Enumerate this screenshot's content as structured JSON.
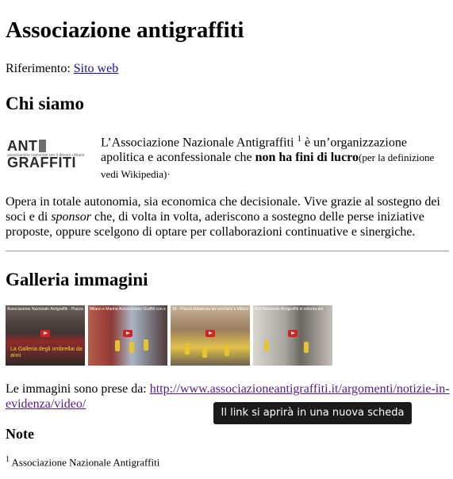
{
  "page": {
    "title": "Associazione antigraffiti"
  },
  "reference": {
    "label": "Riferimento:",
    "link_text": "Sito web"
  },
  "about": {
    "heading": "Chi siamo",
    "logo_text_a": "ANT",
    "logo_text_b": "GRAFFITI",
    "logo_subtitle": "associazione nazionale per il decoro urbano",
    "intro_part1": "L’Associazione Nazionale Antigraffiti",
    "intro_sup": "1",
    "intro_part2": "è un’organizzazione apolitica e aconfessionale che",
    "intro_bold": "non ha fini di lucro",
    "intro_small": "(per la definizione",
    "intro_line3": "vedi Wikipedia)",
    "intro_end": "·",
    "para_part1": "Opera in totale autonomia, sia economica che decisionale. Vive grazie al sostegno dei soci e di",
    "para_em": "sponsor",
    "para_part2": "che, di volta in volta, aderiscono a sostegno delle perse iniziative proposte, oppure scelgono di optare per collaborazioni continuative e sinergiche."
  },
  "gallery": {
    "heading": "Galleria immagini",
    "thumbs": [
      {
        "caption": "Associazione Nazionale Antigraffiti - Piazza Malatesta Galleria",
        "overlay": "La Galleria degli ombrellai da anni"
      },
      {
        "caption": "Milano e Marina Associazione Graffiti con e leggere il",
        "overlay": ""
      },
      {
        "caption": "18 - Piazza Malatesta da vent'anni a Milano",
        "overlay": ""
      },
      {
        "caption": "Ass Nazionale Antigraffiti in volonta del",
        "overlay": ""
      }
    ],
    "source_label": "Le immagini sono prese da:",
    "source_link": "http://www.associazioneantigraffiti.it/argomenti/notizie-in-evidenza/video/"
  },
  "tooltip": {
    "text": "Il link si aprirà in una nuova scheda"
  },
  "notes": {
    "heading": "Note",
    "items": [
      {
        "num": "1",
        "text": "Associazione Nazionale Antigraffiti"
      }
    ]
  }
}
